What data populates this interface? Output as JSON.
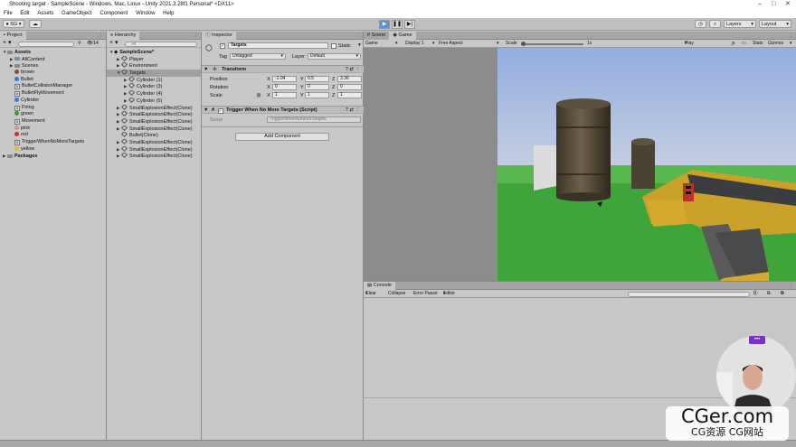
{
  "window": {
    "title": "Shooting target - SampleScene - Windows, Mac, Linux - Unity 2021.3.28f1 Personal* <DX11>"
  },
  "menu": [
    "File",
    "Edit",
    "Assets",
    "GameObject",
    "Component",
    "Window",
    "Help"
  ],
  "toolbar": {
    "account": "SG",
    "layers": "Layers",
    "layout": "Layout"
  },
  "project": {
    "tab": "Project",
    "count": "14",
    "items": [
      {
        "label": "Assets",
        "kind": "folder",
        "indent": 0,
        "caret": "▼",
        "bold": true
      },
      {
        "label": "AllContent",
        "kind": "folder",
        "indent": 1,
        "caret": "▶"
      },
      {
        "label": "Scenes",
        "kind": "folder",
        "indent": 1,
        "caret": "▶"
      },
      {
        "label": "brown",
        "kind": "material",
        "color": "#7a5230",
        "indent": 1
      },
      {
        "label": "Bullet",
        "kind": "prefab",
        "color": "#3b7bd6",
        "indent": 1
      },
      {
        "label": "BulletCollisionManager",
        "kind": "script",
        "indent": 1
      },
      {
        "label": "BulletFlyMovement",
        "kind": "script",
        "indent": 1
      },
      {
        "label": "Cylinder",
        "kind": "prefab",
        "color": "#3b7bd6",
        "indent": 1
      },
      {
        "label": "Firing",
        "kind": "script",
        "indent": 1
      },
      {
        "label": "green",
        "kind": "material",
        "color": "#3a9a3a",
        "indent": 1
      },
      {
        "label": "Movement",
        "kind": "script",
        "indent": 1
      },
      {
        "label": "pink",
        "kind": "material",
        "color": "#d48ab6",
        "indent": 1
      },
      {
        "label": "red",
        "kind": "material",
        "color": "#c43131",
        "indent": 1
      },
      {
        "label": "TriggerWhenNoMoreTargets",
        "kind": "script",
        "indent": 1
      },
      {
        "label": "yellow",
        "kind": "material",
        "color": "#d6c230",
        "indent": 1
      },
      {
        "label": "Packages",
        "kind": "folder",
        "indent": 0,
        "caret": "▶",
        "bold": true
      }
    ]
  },
  "hierarchy": {
    "tab": "Hierarchy",
    "search_placeholder": "All",
    "items": [
      {
        "label": "SampleScene*",
        "indent": 0,
        "caret": "▼",
        "bold": true
      },
      {
        "label": "Player",
        "indent": 1,
        "caret": "▶"
      },
      {
        "label": "Environment",
        "indent": 1,
        "caret": "▶"
      },
      {
        "label": "Targets",
        "indent": 1,
        "caret": "▼",
        "selected": true
      },
      {
        "label": "Cylinder (1)",
        "indent": 2,
        "caret": "▶"
      },
      {
        "label": "Cylinder (3)",
        "indent": 2,
        "caret": "▶"
      },
      {
        "label": "Cylinder (4)",
        "indent": 2,
        "caret": "▶"
      },
      {
        "label": "Cylinder (5)",
        "indent": 2,
        "caret": "▶"
      },
      {
        "label": "SmallExplosionEffect(Clone)",
        "indent": 1,
        "caret": "▶"
      },
      {
        "label": "SmallExplosionEffect(Clone)",
        "indent": 1,
        "caret": "▶"
      },
      {
        "label": "SmallExplosionEffect(Clone)",
        "indent": 1,
        "caret": "▶"
      },
      {
        "label": "SmallExplosionEffect(Clone)",
        "indent": 1,
        "caret": "▶"
      },
      {
        "label": "Bullet(Clone)",
        "indent": 1,
        "caret": ""
      },
      {
        "label": "SmallExplosionEffect(Clone)",
        "indent": 1,
        "caret": "▶"
      },
      {
        "label": "SmallExplosionEffect(Clone)",
        "indent": 1,
        "caret": "▶"
      },
      {
        "label": "SmallExplosionEffect(Clone)",
        "indent": 1,
        "caret": "▶"
      }
    ]
  },
  "inspector": {
    "tab": "Inspector",
    "object_name": "Targets",
    "static_label": "Static",
    "tag_label": "Tag",
    "tag_value": "Untagged",
    "layer_label": "Layer",
    "layer_value": "Default",
    "transform": {
      "title": "Transform",
      "position": {
        "label": "Position",
        "x": "-1.04",
        "y": "0.5",
        "z": "3.36"
      },
      "rotation": {
        "label": "Rotation",
        "x": "0",
        "y": "0",
        "z": "0"
      },
      "scale": {
        "label": "Scale",
        "x": "1",
        "y": "1",
        "z": "1"
      }
    },
    "script_component": {
      "title": "Trigger When No More Targets (Script)",
      "script_label": "Script",
      "script_value": "TriggerWhenNoMoreTargets"
    },
    "add_component": "Add Component"
  },
  "game": {
    "tabs": [
      "Scene",
      "Game"
    ],
    "mode": "Game",
    "display": "Display 1",
    "aspect": "Free Aspect",
    "scale_label": "Scale",
    "scale_value": "1x",
    "play_focused": "Play Focused",
    "stats": "Stats",
    "gizmos": "Gizmos"
  },
  "console": {
    "tab": "Console",
    "buttons": [
      "Clear",
      "Collapse",
      "Error Pause",
      "Editor"
    ],
    "counts": [
      "0",
      "0",
      "0"
    ]
  },
  "watermark": {
    "main": "CGer.com",
    "sub": "CG资源  CG网站"
  }
}
